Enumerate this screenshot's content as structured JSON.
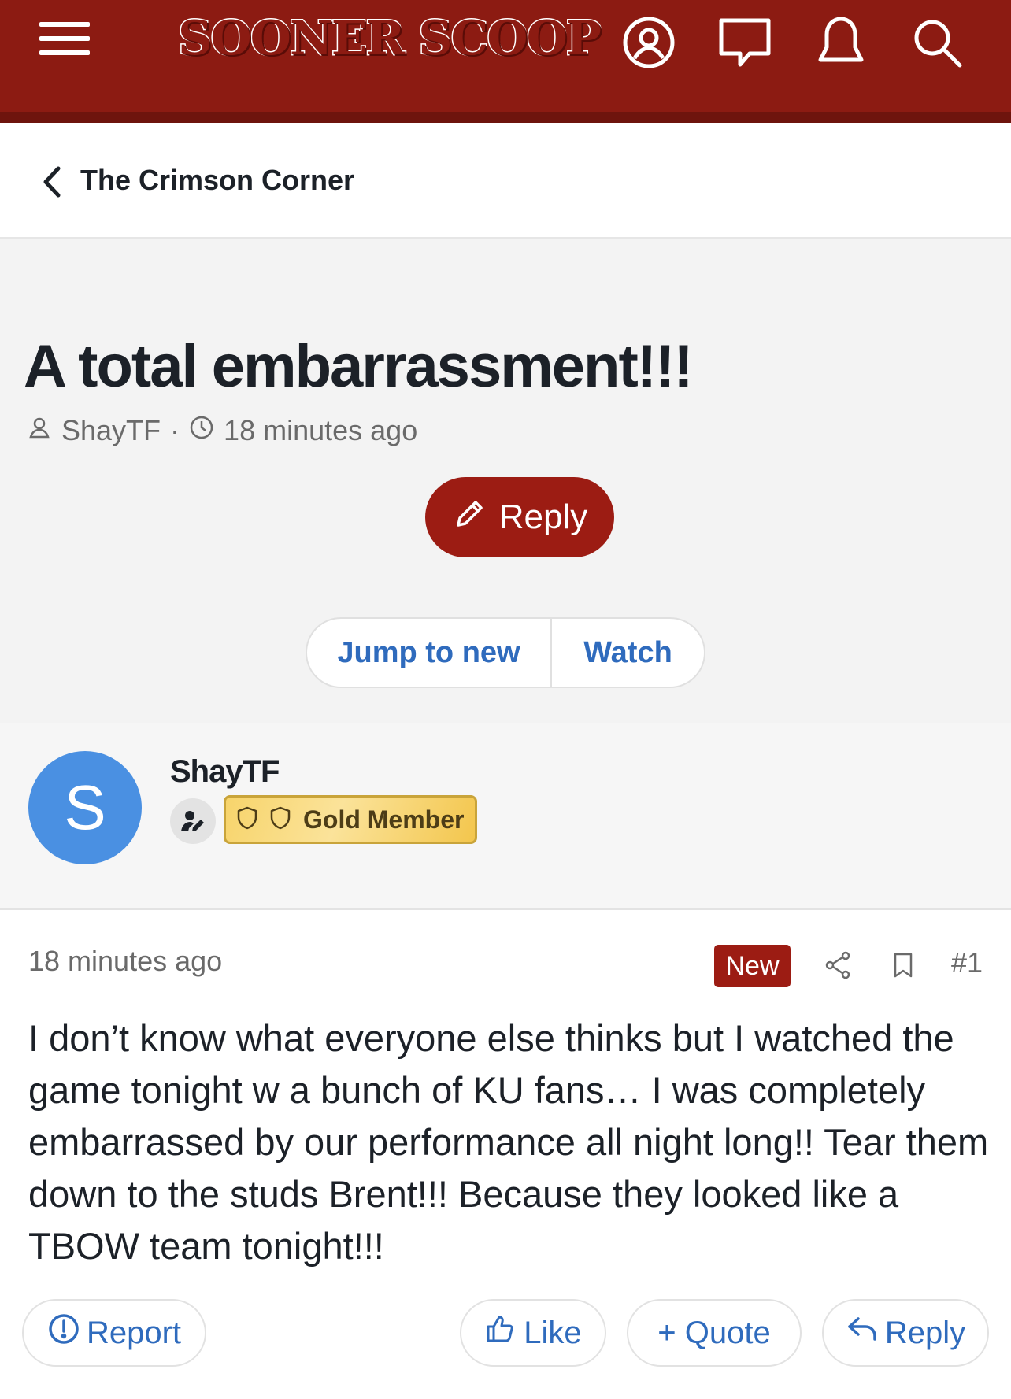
{
  "header": {
    "logo_text": "SOONER SCOOP",
    "icons": [
      "menu-icon",
      "account-icon",
      "messages-icon",
      "alerts-icon",
      "search-icon"
    ],
    "brand_color": "#8c1b12"
  },
  "breadcrumb": {
    "label": "The Crimson Corner"
  },
  "thread": {
    "title": "A total embarrassment!!!",
    "author": "ShayTF",
    "separator": "·",
    "time": "18 minutes ago",
    "reply_label": "Reply",
    "jump_label": "Jump to new",
    "watch_label": "Watch"
  },
  "post_author": {
    "avatar_letter": "S",
    "avatar_color": "#4a90e2",
    "name": "ShayTF",
    "badge_label": "Gold Member"
  },
  "post": {
    "time": "18 minutes ago",
    "new_badge": "New",
    "number": "#1",
    "body": "I don’t know what everyone else thinks but I watched the game tonight w a bunch of KU fans… I was completely embarrassed by our performance all night long!! Tear them down to the studs Brent!!! Because they looked like a TBOW team tonight!!!"
  },
  "actions": {
    "report": "Report",
    "like": "Like",
    "quote": "+ Quote",
    "reply": "Reply"
  }
}
